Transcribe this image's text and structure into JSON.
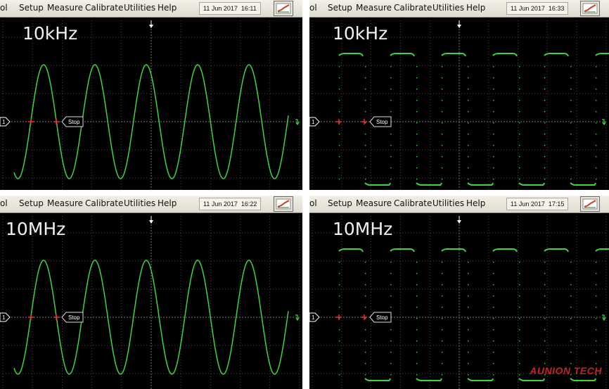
{
  "menu": {
    "control_suffix": "ol",
    "items": [
      "Setup",
      "Measure",
      "Calibrate",
      "Utilities",
      "Help"
    ]
  },
  "stop_label": "Stop",
  "trigger_marker": "1",
  "watermark": "AUNION TECH",
  "panels": [
    {
      "date": "11 Jun 2017",
      "time": "16:11",
      "freq_label": "10kHz",
      "waveform": "sine"
    },
    {
      "date": "11 Jun 2017",
      "time": "16:33",
      "freq_label": "10kHz",
      "waveform": "square"
    },
    {
      "date": "11 Jun 2017",
      "time": "16:22",
      "freq_label": "10MHz",
      "waveform": "sine"
    },
    {
      "date": "11 Jun 2017",
      "time": "17:15",
      "freq_label": "10MHz",
      "waveform": "square"
    }
  ],
  "colors": {
    "trace": "#3fd43f",
    "grid": "#4a4a4a",
    "marker": "#ff2a2a"
  }
}
